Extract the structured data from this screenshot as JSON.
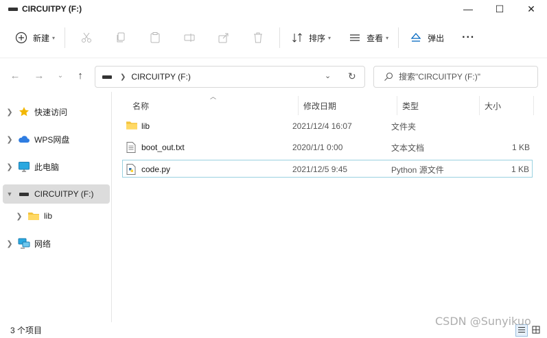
{
  "window": {
    "title": "CIRCUITPY (F:)",
    "controls": {
      "minimize": "—",
      "maximize": "☐",
      "close": "✕"
    }
  },
  "toolbar": {
    "new_label": "新建",
    "sort_label": "排序",
    "view_label": "查看",
    "eject_label": "弹出",
    "more_label": "···",
    "icons": [
      "plus-circle-icon",
      "cut-icon",
      "copy-icon",
      "paste-icon",
      "rename-icon",
      "share-icon",
      "delete-icon",
      "sort-icon",
      "view-icon",
      "eject-icon",
      "more-icon"
    ]
  },
  "nav": {
    "address": "CIRCUITPY (F:)",
    "search_placeholder": "搜索\"CIRCUITPY (F:)\""
  },
  "sidebar": {
    "items": [
      {
        "label": "快速访问",
        "icon": "star-icon"
      },
      {
        "label": "WPS网盘",
        "icon": "cloud-icon"
      },
      {
        "label": "此电脑",
        "icon": "monitor-icon"
      },
      {
        "label": "CIRCUITPY (F:)",
        "icon": "drive-icon",
        "selected": true
      },
      {
        "label": "lib",
        "icon": "folder-icon"
      },
      {
        "label": "网络",
        "icon": "network-icon"
      }
    ]
  },
  "columns": {
    "name": "名称",
    "date": "修改日期",
    "type": "类型",
    "size": "大小"
  },
  "files": [
    {
      "name": "lib",
      "date": "2021/12/4 16:07",
      "type": "文件夹",
      "size": "",
      "icon": "folder-icon"
    },
    {
      "name": "boot_out.txt",
      "date": "2020/1/1 0:00",
      "type": "文本文档",
      "size": "1 KB",
      "icon": "text-file-icon"
    },
    {
      "name": "code.py",
      "date": "2021/12/5 9:45",
      "type": "Python 源文件",
      "size": "1 KB",
      "icon": "python-file-icon"
    }
  ],
  "status": {
    "item_count": "3 个项目"
  },
  "watermark": "CSDN @Sunyikuo",
  "colors": {
    "accent": "#0067c0",
    "folder": "#f3c33c",
    "selected_bg": "#dcdcdc"
  }
}
